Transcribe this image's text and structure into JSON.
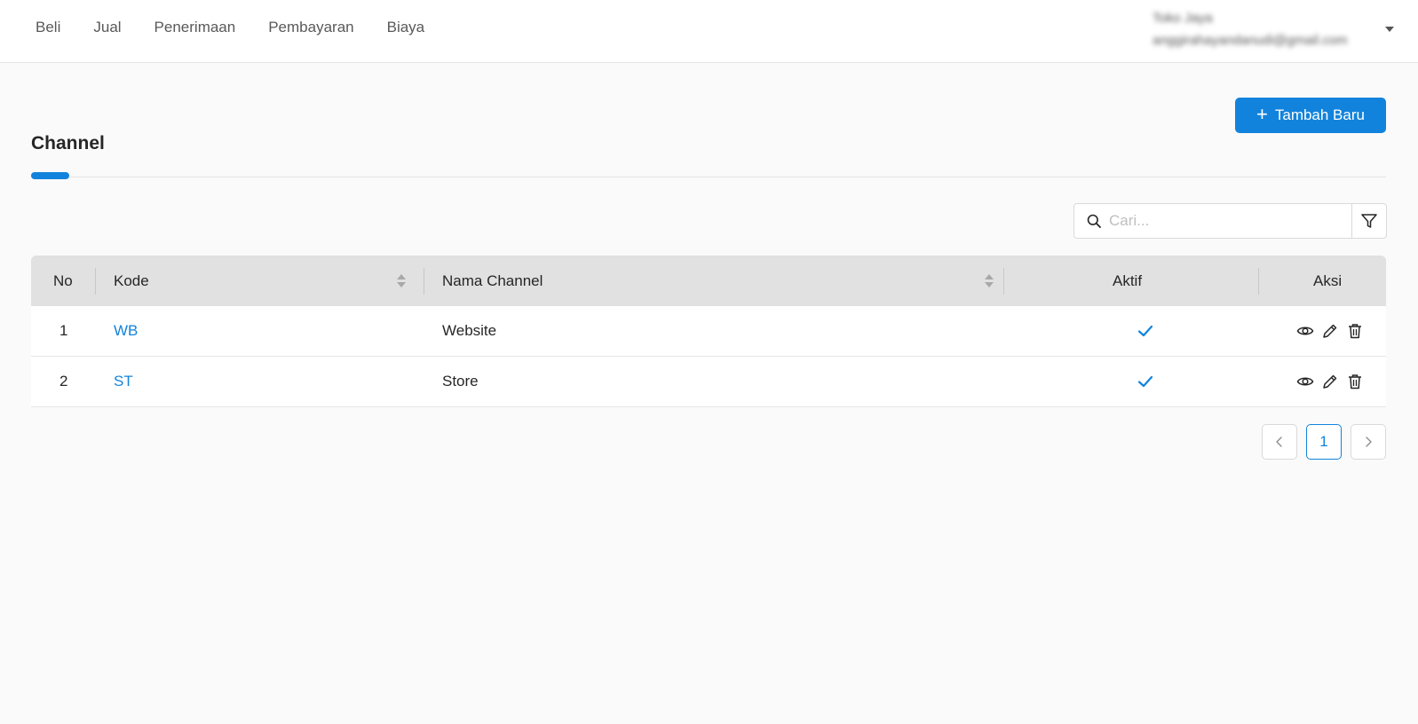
{
  "nav": {
    "items": [
      "Beli",
      "Jual",
      "Penerimaan",
      "Pembayaran",
      "Biaya"
    ]
  },
  "user": {
    "name": "Toko Jaya",
    "email": "anggirahayandanudi@gmail.com"
  },
  "header": {
    "add_button": "Tambah Baru",
    "add_icon": "+",
    "title": "Channel"
  },
  "search": {
    "placeholder": "Cari..."
  },
  "table": {
    "columns": [
      "No",
      "Kode",
      "Nama Channel",
      "Aktif",
      "Aksi"
    ],
    "rows": [
      {
        "no": "1",
        "kode": "WB",
        "nama": "Website",
        "aktif": true
      },
      {
        "no": "2",
        "kode": "ST",
        "nama": "Store",
        "aktif": true
      }
    ]
  },
  "pagination": {
    "current": "1"
  },
  "colors": {
    "accent": "#1283dc",
    "header_bg": "#e1e1e1",
    "page_bg": "#fafafa"
  },
  "icons": [
    "search-icon",
    "filter-icon",
    "sort-icon",
    "check-icon",
    "eye-icon",
    "pencil-icon",
    "trash-icon",
    "chevron-left-icon",
    "chevron-right-icon",
    "caret-down-icon"
  ]
}
